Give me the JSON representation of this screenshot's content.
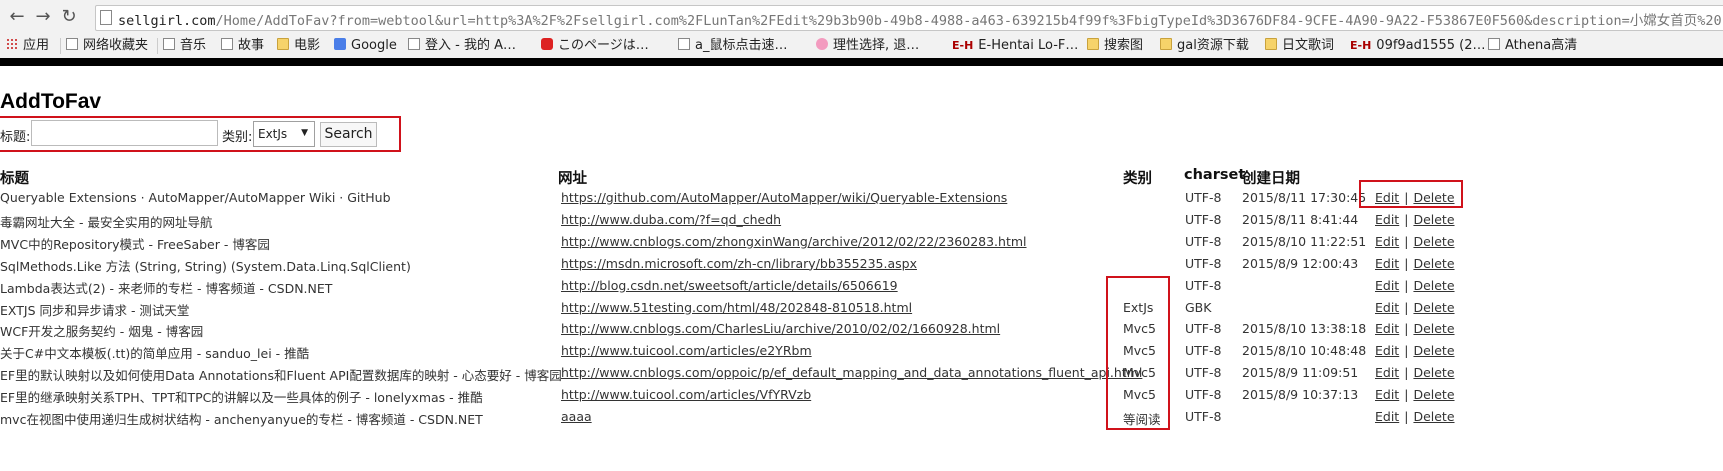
{
  "browser": {
    "url_host": "sellgirl.com",
    "url_rest": "/Home/AddToFav?from=webtool&url=http%3A%2F%2Fsellgirl.com%2FLunTan%2FEdit%29b3b90b-49b8-4988-a463-639215b4f99f%3FbigTypeId%3D3676DF84-9CFE-4A90-9A22-F53867E0F560&description=小嫦女首页%20",
    "bookmarks": [
      {
        "label": "应用",
        "icon": "apps-icon"
      },
      {
        "label": "网络收藏夹",
        "icon": "page-icon"
      },
      {
        "label": "音乐",
        "icon": "page-icon"
      },
      {
        "label": "故事",
        "icon": "page-icon"
      },
      {
        "label": "电影",
        "icon": "folder-icon"
      },
      {
        "label": "Google",
        "icon": "google-icon"
      },
      {
        "label": "登入 - 我的 A…",
        "icon": "page-icon"
      },
      {
        "label": "このページは…",
        "icon": "red-d-icon"
      },
      {
        "label": "a_鼠标点击速…",
        "icon": "page-icon"
      },
      {
        "label": "理性选择, 退…",
        "icon": "flower-icon"
      },
      {
        "label": "E-Hentai Lo-F…",
        "icon": "eh-icon"
      },
      {
        "label": "搜索图",
        "icon": "folder-icon"
      },
      {
        "label": "gal资源下载",
        "icon": "folder-icon"
      },
      {
        "label": "日文歌词",
        "icon": "folder-icon"
      },
      {
        "label": "09f9ad1555 (2…",
        "icon": "eh-icon"
      },
      {
        "label": "Athena高清",
        "icon": "page-icon"
      }
    ]
  },
  "page": {
    "title": "AddToFav",
    "form": {
      "title_label": "标题:",
      "title_value": "",
      "type_label": "类别:",
      "type_selected": "ExtJs",
      "search_label": "Search"
    },
    "table": {
      "headers": {
        "title": "标题",
        "url": "网址",
        "type": "类别",
        "charset": "charset",
        "date": "创建日期"
      },
      "edit_label": "Edit",
      "delete_label": "Delete",
      "rows": [
        {
          "title": "Queryable Extensions · AutoMapper/AutoMapper Wiki · GitHub",
          "url": "https://github.com/AutoMapper/AutoMapper/wiki/Queryable-Extensions",
          "type": "",
          "charset": "UTF-8",
          "date": "2015/8/11 17:30:45"
        },
        {
          "title": "毒霸网址大全 - 最安全实用的网址导航",
          "url": "http://www.duba.com/?f=qd_chedh",
          "type": "",
          "charset": "UTF-8",
          "date": "2015/8/11 8:41:44"
        },
        {
          "title": "MVC中的Repository模式 - FreeSaber - 博客园",
          "url": "http://www.cnblogs.com/zhongxinWang/archive/2012/02/22/2360283.html",
          "type": "",
          "charset": "UTF-8",
          "date": "2015/8/10 11:22:51"
        },
        {
          "title": "SqlMethods.Like 方法 (String, String) (System.Data.Linq.SqlClient)",
          "url": "https://msdn.microsoft.com/zh-cn/library/bb355235.aspx",
          "type": "",
          "charset": "UTF-8",
          "date": "2015/8/9 12:00:43"
        },
        {
          "title": "Lambda表达式(2) - 来老师的专栏 - 博客频道 - CSDN.NET",
          "url": "http://blog.csdn.net/sweetsoft/article/details/6506619",
          "type": "",
          "charset": "UTF-8",
          "date": ""
        },
        {
          "title": "EXTJS 同步和异步请求 - 测试天堂",
          "url": "http://www.51testing.com/html/48/202848-810518.html",
          "type": "ExtJs",
          "charset": "GBK",
          "date": ""
        },
        {
          "title": "WCF开发之服务契约 - 烟鬼 - 博客园",
          "url": "http://www.cnblogs.com/CharlesLiu/archive/2010/02/02/1660928.html",
          "type": "Mvc5",
          "charset": "UTF-8",
          "date": "2015/8/10 13:38:18"
        },
        {
          "title": "关于C#中文本模板(.tt)的简单应用 - sanduo_lei - 推酷",
          "url": "http://www.tuicool.com/articles/e2YRbm",
          "type": "Mvc5",
          "charset": "UTF-8",
          "date": "2015/8/10 10:48:48"
        },
        {
          "title": "EF里的默认映射以及如何使用Data Annotations和Fluent API配置数据库的映射 - 心态要好 - 博客园",
          "url": "http://www.cnblogs.com/oppoic/p/ef_default_mapping_and_data_annotations_fluent_api.html",
          "type": "Mvc5",
          "charset": "UTF-8",
          "date": "2015/8/9 11:09:51"
        },
        {
          "title": "EF里的继承映射关系TPH、TPT和TPC的讲解以及一些具体的例子 - lonelyxmas - 推酷",
          "url": "http://www.tuicool.com/articles/VfYRVzb",
          "type": "Mvc5",
          "charset": "UTF-8",
          "date": "2015/8/9 10:37:13"
        },
        {
          "title": "mvc在视图中使用递归生成树状结构 - anchenyanyue的专栏 - 博客频道 - CSDN.NET",
          "url": "aaaa",
          "type": "等阅读",
          "charset": "UTF-8",
          "date": ""
        }
      ]
    }
  }
}
